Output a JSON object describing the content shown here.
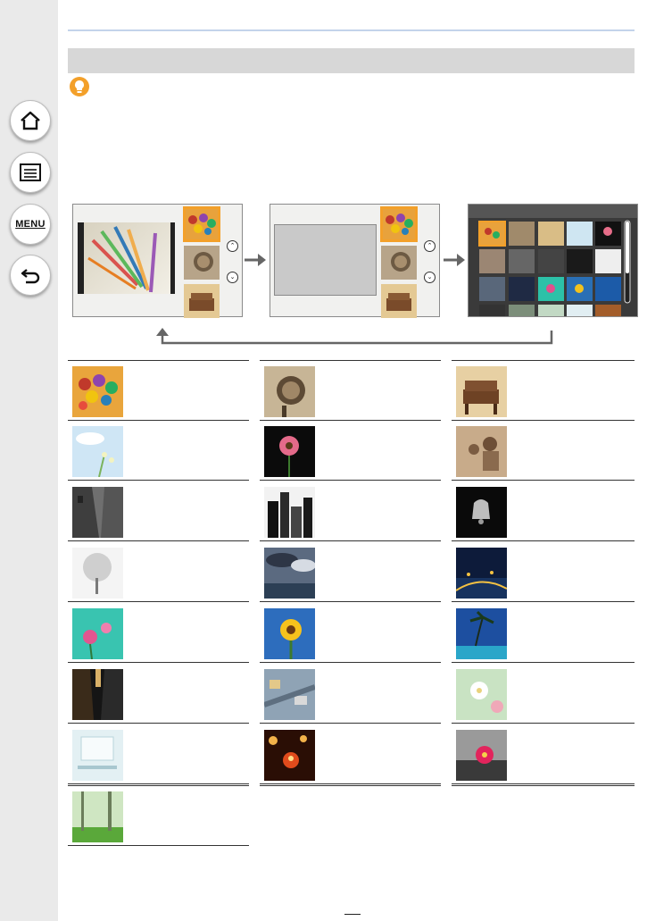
{
  "sidebar": {
    "buttons": [
      {
        "name": "home-button",
        "icon": "home-icon"
      },
      {
        "name": "contents-button",
        "icon": "list-icon"
      },
      {
        "name": "menu-button",
        "label": "MENU"
      },
      {
        "name": "back-button",
        "icon": "back-arrow-icon"
      }
    ]
  },
  "tip_icon": "lightbulb-icon",
  "colors": {
    "accent": "#f3a02a",
    "rule": "#c3d3ea",
    "header_bar": "#d7d7d7",
    "sidebar_bg": "#eaeaea"
  },
  "flow": {
    "screens": [
      "single-preview-screen",
      "blank-preview-screen",
      "thumbnail-grid-screen"
    ],
    "arrows": [
      "right-arrow-icon",
      "right-arrow-icon",
      "return-arrow-icon"
    ]
  },
  "filter_thumbnails": [
    "candy-photo",
    "pocket-watch-photo",
    "sepia-chair-photo",
    "sky-flowers-photo",
    "pink-flower-photo",
    "mother-child-photo",
    "street-photo",
    "city-buildings-photo",
    "bell-photo",
    "tree-photo",
    "clouds-harbor-photo",
    "night-city-photo",
    "cosmos-flowers-photo",
    "sunflower-photo",
    "palm-beach-photo",
    "alley-photo",
    "miniature-town-photo",
    "white-flowers-photo",
    "window-room-photo",
    "candle-photo",
    "pink-flower-partial-color-photo",
    "forest-sunbeam-photo"
  ]
}
